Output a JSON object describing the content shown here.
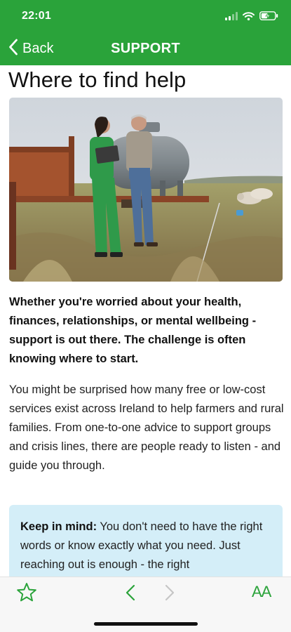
{
  "status": {
    "time": "22:01"
  },
  "nav": {
    "back_label": "Back",
    "title": "SUPPORT"
  },
  "article": {
    "heading": "Where to find help",
    "lead": "Whether you're worried about your health, finances, relationships, or mental wellbeing - support is out there. The challenge is often knowing where to start.",
    "body": "You might be surprised how many free or low-cost services exist across Ireland to help farmers and rural families. From one-to-one advice to support groups and crisis lines, there are people ready to listen - and guide you through.",
    "callout": {
      "label": "Keep in mind:",
      "text": " You don't need to have the right words or know exactly what you need. Just reaching out is enough - the right"
    }
  },
  "toolbar": {
    "text_size_label": "AA"
  },
  "colors": {
    "brand": "#2aa33a",
    "callout_bg": "#d4eef8",
    "disabled": "#c6c6c6"
  },
  "icons": [
    "back-chevron-icon",
    "signal-icon",
    "wifi-icon",
    "battery-icon",
    "star-icon",
    "chevron-left-icon",
    "chevron-right-icon",
    "text-size-icon"
  ]
}
